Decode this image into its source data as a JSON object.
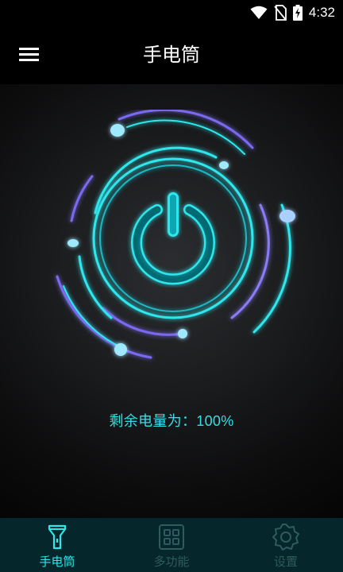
{
  "status_bar": {
    "time": "4:32",
    "icons": [
      "wifi-icon",
      "no-sim-icon",
      "battery-charging-icon"
    ]
  },
  "app_bar": {
    "title": "手电筒",
    "menu_icon": "menu-icon"
  },
  "main": {
    "power_button_icon": "power-icon",
    "battery_text": "剩余电量为：100%"
  },
  "tabs": [
    {
      "label": "手电筒",
      "icon": "flashlight-icon",
      "active": true
    },
    {
      "label": "多功能",
      "icon": "grid-icon",
      "active": false
    },
    {
      "label": "设置",
      "icon": "settings-gear-icon",
      "active": false
    }
  ],
  "colors": {
    "accent": "#2ee6ec",
    "ring_purple": "#7a6bf0",
    "tab_bg": "#05262a",
    "tab_inactive": "#2f5a5e"
  }
}
